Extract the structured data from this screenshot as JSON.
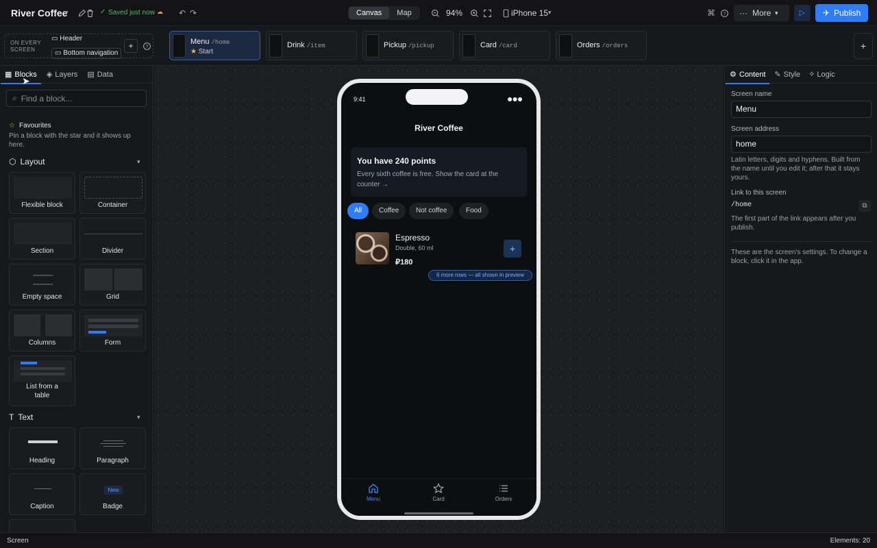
{
  "topbar": {
    "app_name": "River Coffee",
    "saved": "Saved just now",
    "views": [
      "Canvas",
      "Map"
    ],
    "zoom": "94%",
    "device": "iPhone 15",
    "more": "More",
    "publish": "Publish"
  },
  "strip": {
    "every_label_1": "ON EVERY",
    "every_label_2": "SCREEN",
    "header": "Header",
    "bottom_nav": "Bottom navigation",
    "screens": [
      {
        "name": "Menu",
        "path": "/home",
        "badge": "Start"
      },
      {
        "name": "Drink",
        "path": "/item"
      },
      {
        "name": "Pickup",
        "path": "/pickup"
      },
      {
        "name": "Card",
        "path": "/card"
      },
      {
        "name": "Orders",
        "path": "/orders"
      }
    ]
  },
  "left": {
    "tabs": [
      "Blocks",
      "Layers",
      "Data"
    ],
    "search_placeholder": "Find a block...",
    "favourites": "Favourites",
    "favourites_hint": "Pin a block with the star and it shows up here.",
    "layout_title": "Layout",
    "layout_blocks": [
      "Flexible block",
      "Container",
      "Section",
      "Divider",
      "Empty space",
      "Grid",
      "Columns",
      "Form",
      "List from a table"
    ],
    "text_title": "Text",
    "text_blocks": [
      "Heading",
      "Paragraph",
      "Caption",
      "Badge"
    ],
    "badge_preview": "New"
  },
  "phone": {
    "time": "9:41",
    "title": "River Coffee",
    "points_title": "You have 240 points",
    "points_text": "Every sixth coffee is free. Show the card at the counter →",
    "chips": [
      "All",
      "Coffee",
      "Not coffee",
      "Food"
    ],
    "item_name": "Espresso",
    "item_desc": "Double, 60 ml",
    "item_price": "₽180",
    "more_rows": "6 more rows — all shown in preview",
    "nav": [
      "Menu",
      "Card",
      "Orders"
    ]
  },
  "right": {
    "tabs": [
      "Content",
      "Style",
      "Logic"
    ],
    "screen_name_label": "Screen name",
    "screen_name": "Menu",
    "screen_address_label": "Screen address",
    "screen_address": "home",
    "address_hint": "Latin letters, digits and hyphens. Built from the name until you edit it; after that it stays yours.",
    "link_label": "Link to this screen",
    "link": "/home",
    "link_hint": "The first part of the link appears after you publish.",
    "footer_hint": "These are the screen's settings. To change a block, click it in the app."
  },
  "status": {
    "left": "Screen",
    "right": "Elements: 20"
  },
  "colors": {
    "accent": "#2f7df6",
    "background": "#141416",
    "panel": "#17181b"
  }
}
